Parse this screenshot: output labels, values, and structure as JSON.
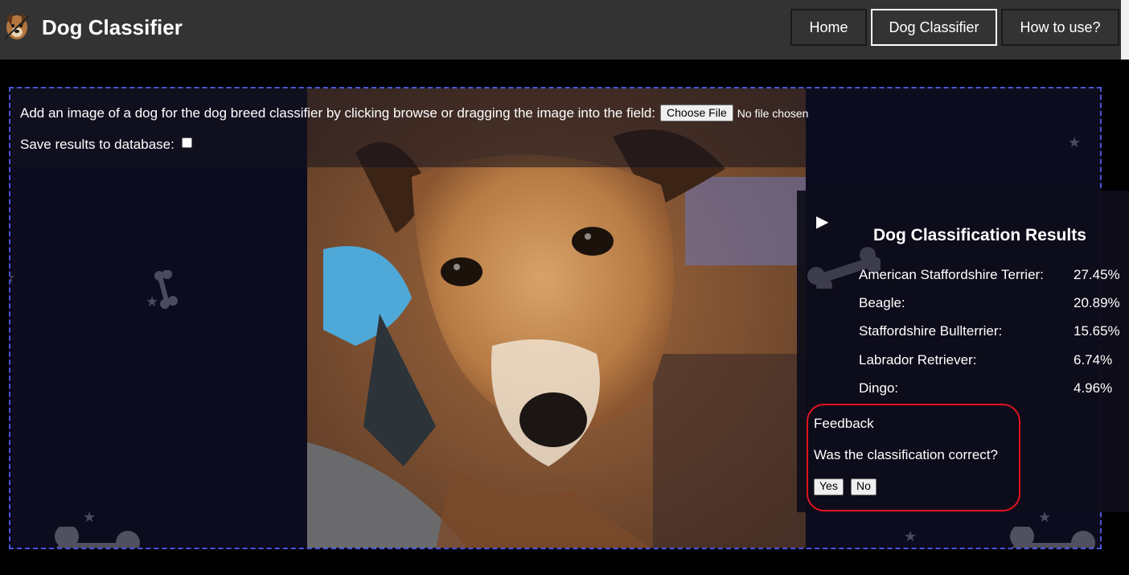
{
  "header": {
    "title": "Dog Classifier",
    "nav": [
      {
        "label": "Home",
        "active": false
      },
      {
        "label": "Dog Classifier",
        "active": true
      },
      {
        "label": "How to use?",
        "active": false
      }
    ]
  },
  "upload": {
    "prompt": "Add an image of a dog for the dog breed classifier by clicking browse or dragging the image into the field:",
    "choose_file_label": "Choose File",
    "file_status": "No file chosen",
    "save_label": "Save results to database:",
    "save_checked": false
  },
  "results": {
    "title": "Dog Classification Results",
    "breeds": [
      {
        "name": "American Staffordshire Terrier:",
        "pct": "27.45%"
      },
      {
        "name": "Beagle:",
        "pct": "20.89%"
      },
      {
        "name": "Staffordshire Bullterrier:",
        "pct": "15.65%"
      },
      {
        "name": "Labrador Retriever:",
        "pct": "6.74%"
      },
      {
        "name": "Dingo:",
        "pct": "4.96%"
      }
    ]
  },
  "feedback": {
    "title": "Feedback",
    "question": "Was the classification correct?",
    "yes_label": "Yes",
    "no_label": "No"
  },
  "colors": {
    "header_bg": "#333333",
    "dropzone_border": "#4a56d6",
    "dropzone_bg": "#0d0c1f",
    "feedback_border": "#e0141e"
  },
  "icons": [
    "dog-logo-icon",
    "play-icon",
    "bone-icon",
    "star-icon"
  ]
}
